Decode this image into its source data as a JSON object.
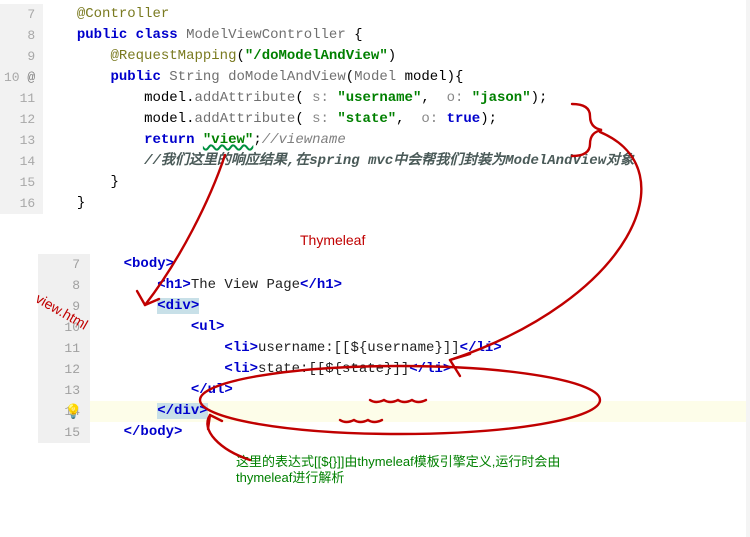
{
  "top": {
    "lineNumbers": [
      "7",
      "8",
      "9",
      "10",
      "11",
      "12",
      "13",
      "14",
      "15",
      "16"
    ],
    "gutterAnnotation": "@",
    "line7_annot": "@Controller",
    "line8_kw1": "public",
    "line8_kw2": "class",
    "line8_cls": "ModelViewController",
    "line8_brace": " {",
    "line9_annot": "@RequestMapping",
    "line9_str": "\"/doModelAndView\"",
    "line10_kw1": "public",
    "line10_type": "String",
    "line10_meth": "doModelAndView",
    "line10_ptype": "Model",
    "line10_pname": "model",
    "line11_recv": "model",
    "line11_meth": "addAttribute",
    "line11_h1": "s:",
    "line11_s1": "\"username\"",
    "line11_h2": "o:",
    "line11_s2": "\"jason\"",
    "line12_recv": "model",
    "line12_meth": "addAttribute",
    "line12_h1": "s:",
    "line12_s1": "\"state\"",
    "line12_h2": "o:",
    "line12_b": "true",
    "line13_ret": "return",
    "line13_val": "\"view\"",
    "line13_semi": ";",
    "line13_cmt": "//viewname",
    "line14_cmt": "//我们这里的响应结果,在spring mvc中会帮我们封装为ModelAndView对象",
    "line15_brace": "}",
    "line16_brace": "}"
  },
  "labels": {
    "thymeleaf": "Thymeleaf",
    "viewhtml": "view.html"
  },
  "bottom": {
    "lineNumbers": [
      "7",
      "8",
      "9",
      "10",
      "11",
      "12",
      "13",
      "14",
      "15"
    ],
    "line7": {
      "indent": "    ",
      "open": "<body>"
    },
    "line8": {
      "indent": "        ",
      "open": "<h1>",
      "text": "The View Page",
      "close": "</h1>"
    },
    "line9": {
      "indent": "        ",
      "open": "<div>"
    },
    "line10": {
      "indent": "            ",
      "open": "<ul>"
    },
    "line11": {
      "indent": "                ",
      "open": "<li>",
      "text": "username:[[${username}]]",
      "close": "</li>"
    },
    "line12": {
      "indent": "                ",
      "open": "<li>",
      "text": "state:[[${state}]]",
      "close": "</li>"
    },
    "line13": {
      "indent": "            ",
      "open": "</ul>"
    },
    "line14": {
      "indent": "        ",
      "open": "</div>"
    },
    "line15": {
      "indent": "    ",
      "open": "</body>"
    }
  },
  "notes": {
    "bottomLine1": "这里的表达式[[${}]]由thymeleaf模板引擎定义,运行时会由",
    "bottomLine2": "thymeleaf进行解析"
  }
}
